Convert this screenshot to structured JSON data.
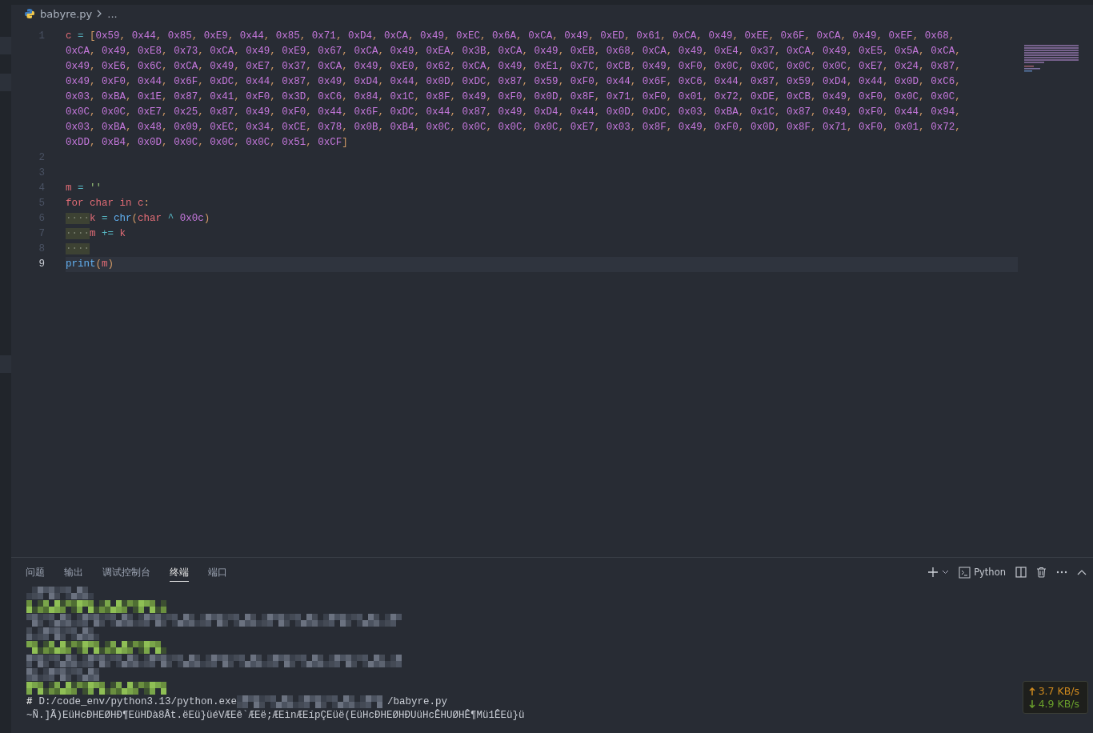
{
  "breadcrumb": {
    "file": "babyre.py",
    "more": "..."
  },
  "code": [
    {
      "number": "1",
      "current": false,
      "rows": [
        "c = [0x59, 0x44, 0x85, 0xE9, 0x44, 0x85, 0x71, 0xD4, 0xCA, 0x49, 0xEC, 0x6A, 0xCA, 0x49, 0xED, 0x61, 0xCA, 0x49, 0xEE, 0x6F, 0xCA, 0x49, 0xEF, 0x68,",
        "0xCA, 0x49, 0xE8, 0x73, 0xCA, 0x49, 0xE9, 0x67, 0xCA, 0x49, 0xEA, 0x3B, 0xCA, 0x49, 0xEB, 0x68, 0xCA, 0x49, 0xE4, 0x37, 0xCA, 0x49, 0xE5, 0x5A, 0xCA,",
        "0x49, 0xE6, 0x6C, 0xCA, 0x49, 0xE7, 0x37, 0xCA, 0x49, 0xE0, 0x62, 0xCA, 0x49, 0xE1, 0x7C, 0xCB, 0x49, 0xF0, 0x0C, 0x0C, 0x0C, 0x0C, 0xE7, 0x24, 0x87,",
        "0x49, 0xF0, 0x44, 0x6F, 0xDC, 0x44, 0x87, 0x49, 0xD4, 0x44, 0x0D, 0xDC, 0x87, 0x59, 0xF0, 0x44, 0x6F, 0xC6, 0x44, 0x87, 0x59, 0xD4, 0x44, 0x0D, 0xC6,",
        "0x03, 0xBA, 0x1E, 0x87, 0x41, 0xF0, 0x3D, 0xC6, 0x84, 0x1C, 0x8F, 0x49, 0xF0, 0x0D, 0x8F, 0x71, 0xF0, 0x01, 0x72, 0xDE, 0xCB, 0x49, 0xF0, 0x0C, 0x0C,",
        "0x0C, 0x0C, 0xE7, 0x25, 0x87, 0x49, 0xF0, 0x44, 0x6F, 0xDC, 0x44, 0x87, 0x49, 0xD4, 0x44, 0x0D, 0xDC, 0x03, 0xBA, 0x1C, 0x87, 0x49, 0xF0, 0x44, 0x94,",
        "0x03, 0xBA, 0x48, 0x09, 0xEC, 0x34, 0xCE, 0x78, 0x0B, 0xB4, 0x0C, 0x0C, 0x0C, 0x0C, 0xE7, 0x03, 0x8F, 0x49, 0xF0, 0x0D, 0x8F, 0x71, 0xF0, 0x01, 0x72,",
        "0xDD, 0xB4, 0x0D, 0x0C, 0x0C, 0x0C, 0x51, 0xCF]"
      ]
    },
    {
      "number": "2",
      "current": false
    },
    {
      "number": "3",
      "current": false
    },
    {
      "number": "4",
      "current": false,
      "rows": [
        "m = ''"
      ]
    },
    {
      "number": "5",
      "current": false,
      "rows": [
        "for char in c:"
      ]
    },
    {
      "number": "6",
      "current": false,
      "rows": [
        "····k = chr(char ^ 0x0c)"
      ]
    },
    {
      "number": "7",
      "current": false,
      "rows": [
        "····m += k"
      ]
    },
    {
      "number": "8",
      "current": false,
      "rows": [
        "····"
      ]
    },
    {
      "number": "9",
      "current": true,
      "rows": [
        "print(m)"
      ]
    }
  ],
  "panel": {
    "tabs": [
      {
        "label": "问题",
        "selected": false
      },
      {
        "label": "输出",
        "selected": false
      },
      {
        "label": "调试控制台",
        "selected": false
      },
      {
        "label": "终端",
        "selected": true
      },
      {
        "label": "端口",
        "selected": false
      }
    ],
    "shell": "Python",
    "terminal": [
      {
        "kind": "redacted"
      },
      {
        "kind": "redacted"
      },
      {
        "kind": "redacted"
      },
      {
        "kind": "redacted"
      },
      {
        "kind": "redacted"
      },
      {
        "kind": "redacted"
      },
      {
        "kind": "redacted"
      },
      {
        "kind": "redacted"
      },
      {
        "kind": "command",
        "prompt": "#",
        "text": "D:/code_env/python3.13/python.exe",
        "tail": "/babyre.py"
      },
      {
        "kind": "output",
        "text": "~Ñ.]Ã)EüHcÐHEØHÐ¶EüHDà8Ât.ëEü}üéVÆEê`ÆEë;ÆEìnÆEípÇEüë(EüHcÐHEØHÐUüHcÊHUØHÊ¶Mü1ÊEü}ü"
      }
    ]
  },
  "network": {
    "up": "3.7 KB/s",
    "down": "4.9 KB/s"
  }
}
